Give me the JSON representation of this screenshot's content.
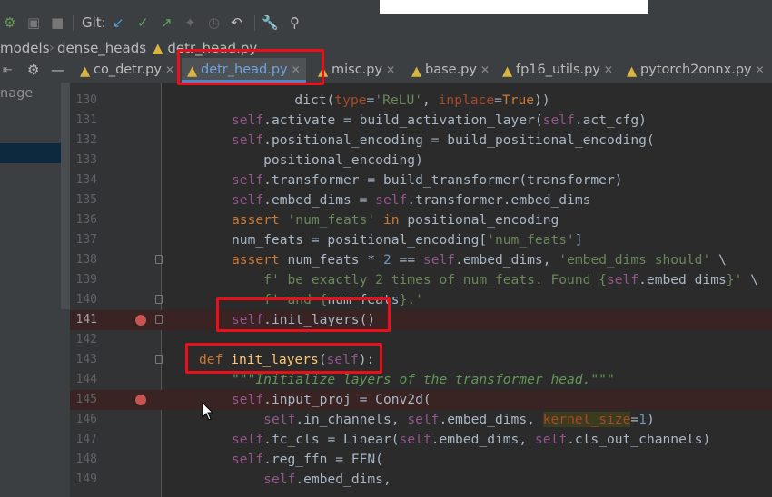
{
  "toolbar": {
    "git_label": "Git:",
    "icons": [
      "bug-icon",
      "coverage-icon",
      "stop-icon",
      "git-update-icon",
      "git-commit-icon",
      "git-push-icon",
      "git-merge-icon",
      "history-icon",
      "rollback-icon",
      "wrench-icon",
      "search-icon"
    ]
  },
  "breadcrumb": {
    "items": [
      "models",
      "dense_heads",
      "detr_head.py"
    ]
  },
  "tabs": [
    {
      "label": "co_detr.py",
      "active": false
    },
    {
      "label": "detr_head.py",
      "active": true
    },
    {
      "label": "misc.py",
      "active": false
    },
    {
      "label": "base.py",
      "active": false
    },
    {
      "label": "fp16_utils.py",
      "active": false
    },
    {
      "label": "pytorch2onnx.py",
      "active": false
    }
  ],
  "left_panel": {
    "label": "nage"
  },
  "editor": {
    "lines": [
      {
        "n": "130",
        "code": "            dict(type='ReLU', inplace=True))"
      },
      {
        "n": "131",
        "code": "self.activate = build_activation_layer(self.act_cfg)"
      },
      {
        "n": "132",
        "code": "self.positional_encoding = build_positional_encoding("
      },
      {
        "n": "133",
        "code": "    positional_encoding)"
      },
      {
        "n": "134",
        "code": "self.transformer = build_transformer(transformer)"
      },
      {
        "n": "135",
        "code": "self.embed_dims = self.transformer.embed_dims"
      },
      {
        "n": "136",
        "code": "assert 'num_feats' in positional_encoding"
      },
      {
        "n": "137",
        "code": "num_feats = positional_encoding['num_feats']"
      },
      {
        "n": "138",
        "code": "assert num_feats * 2 == self.embed_dims, 'embed_dims should' \\"
      },
      {
        "n": "139",
        "code": "    f' be exactly 2 times of num_feats. Found {self.embed_dims}' \\"
      },
      {
        "n": "140",
        "code": "    f' and {num_feats}.'"
      },
      {
        "n": "141",
        "code": "self.init_layers()"
      },
      {
        "n": "142",
        "code": ""
      },
      {
        "n": "143",
        "code": "def init_layers(self):"
      },
      {
        "n": "144",
        "code": "\"\"\"Initialize layers of the transformer head.\"\"\""
      },
      {
        "n": "145",
        "code": "self.input_proj = Conv2d("
      },
      {
        "n": "146",
        "code": "    self.in_channels, self.embed_dims, kernel_size=1)"
      },
      {
        "n": "147",
        "code": "self.fc_cls = Linear(self.embed_dims, self.cls_out_channels)"
      },
      {
        "n": "148",
        "code": "self.reg_ffn = FFN("
      },
      {
        "n": "149",
        "code": "    self.embed_dims,"
      }
    ],
    "breakpoints": [
      "141",
      "145"
    ]
  },
  "colors": {
    "annotation_red": "#e8101a",
    "keyword": "#cc7832",
    "self": "#94558d",
    "string": "#6a8759",
    "function": "#ffc66d"
  }
}
